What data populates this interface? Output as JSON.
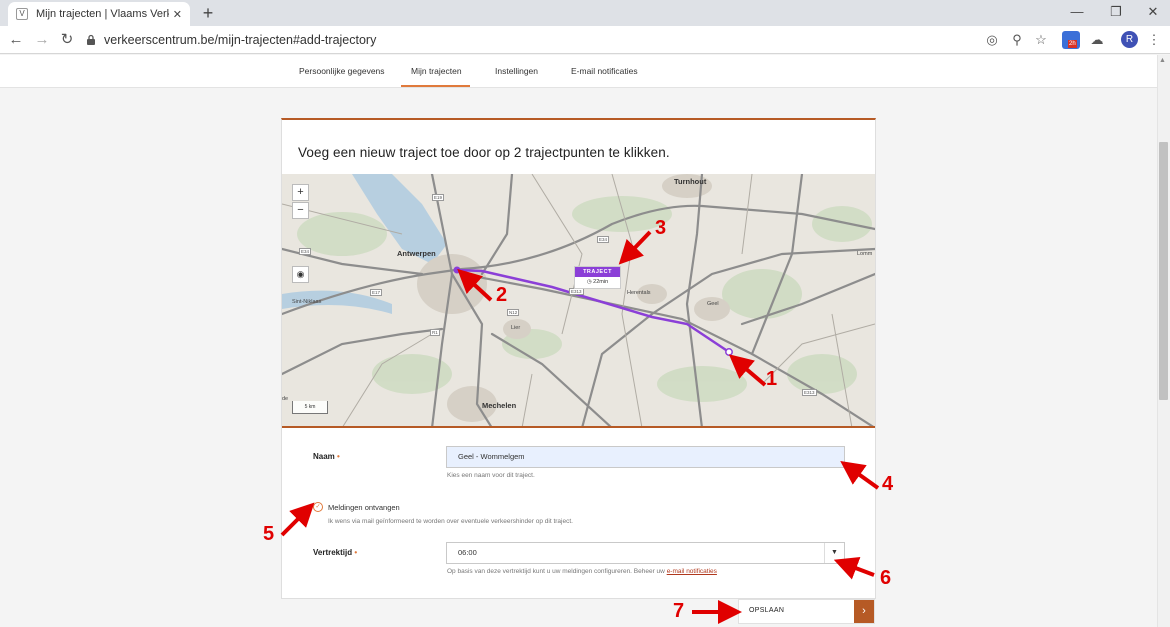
{
  "browser": {
    "tab_title": "Mijn trajecten | Vlaams Verkeersc",
    "tab_close": "✕",
    "new_tab": "+",
    "url": "verkeerscentrum.be/mijn-trajecten#add-trajectory",
    "avatar_letter": "R",
    "ext_badge": "2h"
  },
  "subnav": {
    "items": [
      "Persoonlijke gegevens",
      "Mijn trajecten",
      "Instellingen",
      "E-mail notificaties"
    ]
  },
  "card": {
    "title": "Voeg een nieuw traject toe door op 2 trajectpunten te klikken."
  },
  "map": {
    "zoom_in": "+",
    "zoom_out": "−",
    "scale": "5 km",
    "cities": [
      "Turnhout",
      "Antwerpen",
      "Mechelen"
    ],
    "small_cities": [
      "Sint-Niklaas",
      "Herentals",
      "Geel",
      "Lier",
      "Lomm",
      "de"
    ],
    "badge_title": "TRAJECT",
    "badge_time": "22min",
    "road_labels": [
      "E34",
      "E34",
      "E313",
      "E17",
      "E19",
      "N12",
      "R1",
      "E313"
    ]
  },
  "annotations": [
    "1",
    "2",
    "3",
    "4",
    "5",
    "6",
    "7"
  ],
  "form": {
    "name_label": "Naam",
    "required_mark": "•",
    "name_value": "Geel - Wommelgem",
    "name_help": "Kies een naam voor dit traject.",
    "notify_label": "Meldingen ontvangen",
    "notify_help": "Ik wens via mail geïnformeerd te worden over eventuele verkeershinder op dit traject.",
    "departure_label": "Vertrektijd",
    "departure_value": "06:00",
    "departure_help": "Op basis van deze vertrektijd kunt u uw meldingen configureren. Beheer uw",
    "departure_link": "e-mail notificaties",
    "save_label": "OPSLAAN"
  },
  "colors": {
    "accent": "#b65a25",
    "route": "#8b3fd7",
    "annotation": "#e00000"
  }
}
